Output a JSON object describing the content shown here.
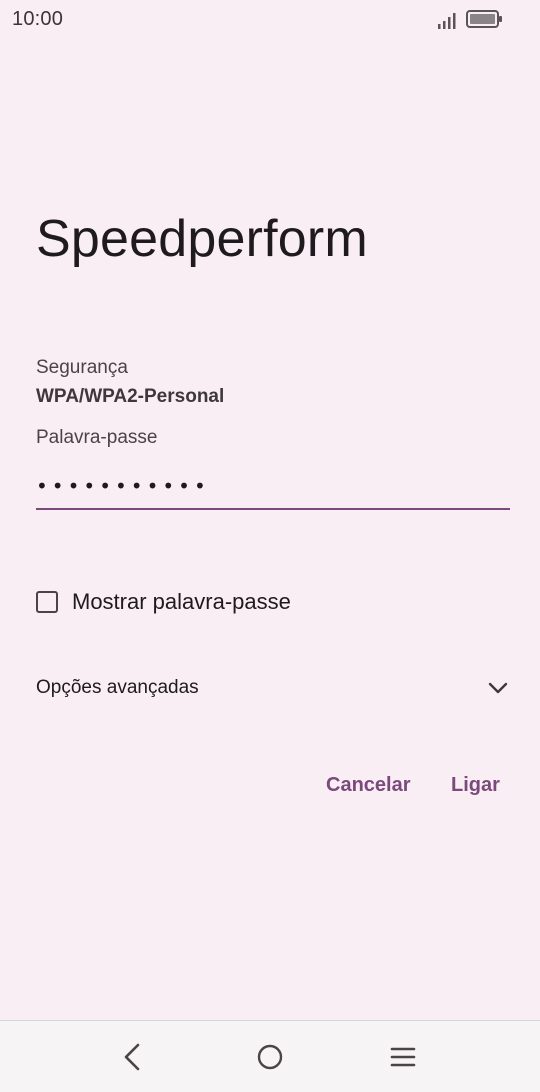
{
  "status_bar": {
    "time": "10:00"
  },
  "dialog": {
    "title": "Speedperform",
    "security_label": "Segurança",
    "security_value": "WPA/WPA2-Personal",
    "password_label": "Palavra-passe",
    "password_value": "•••••••••••",
    "show_password_label": "Mostrar palavra-passe",
    "show_password_checked": false,
    "advanced_options_label": "Opções avançadas",
    "cancel_label": "Cancelar",
    "connect_label": "Ligar"
  },
  "colors": {
    "background": "#F9EEF4",
    "accent": "#7B4A7C",
    "text": "#1F1A1E",
    "nav_bar": "#F7F4F6"
  },
  "icons": {
    "signal": "signal-icon",
    "battery": "battery-icon",
    "chevron": "chevron-down-icon",
    "back": "back-icon",
    "home": "home-icon",
    "menu": "menu-icon"
  }
}
